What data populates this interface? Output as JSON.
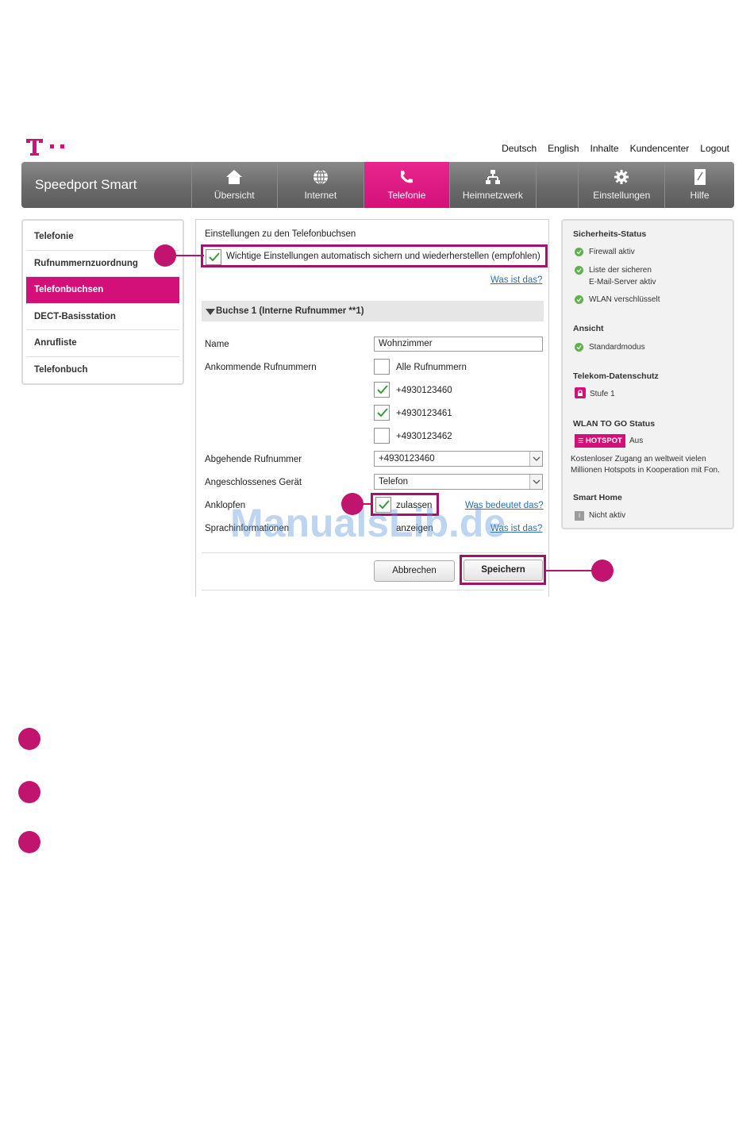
{
  "colors": {
    "magenta": "#d3107a",
    "callout": "#c0146e",
    "nav_gray": "#6a6a6a",
    "link": "#2f6ea8",
    "status_green": "#5fb14b"
  },
  "top_links": [
    "Deutsch",
    "English",
    "Inhalte",
    "Kundencenter",
    "Logout"
  ],
  "brand": "Speedport Smart",
  "nav": [
    {
      "label": "Übersicht",
      "icon": "home-icon"
    },
    {
      "label": "Internet",
      "icon": "globe-icon"
    },
    {
      "label": "Telefonie",
      "icon": "phone-icon",
      "active": true
    },
    {
      "label": "Heimnetzwerk",
      "icon": "network-icon"
    },
    {
      "label": "Einstellungen",
      "icon": "gear-icon"
    },
    {
      "label": "Hilfe",
      "icon": "help-book-icon"
    }
  ],
  "sidebar": {
    "items": [
      {
        "label": "Telefonie"
      },
      {
        "label": "Rufnummernzuordnung"
      },
      {
        "label": "Telefonbuchsen",
        "active": true
      },
      {
        "label": "DECT-Basisstation"
      },
      {
        "label": "Anrufliste"
      },
      {
        "label": "Telefonbuch"
      }
    ]
  },
  "main": {
    "title": "Einstellungen zu den Telefonbuchsen",
    "auto_save_label": "Wichtige Einstellungen automatisch sichern und wiederherstellen (empfohlen)",
    "auto_save_checked": true,
    "help_link": "Was ist das?",
    "section_title": "Buchse 1 (Interne Rufnummer **1)",
    "name_label": "Name",
    "name_value": "Wohnzimmer",
    "incoming_label": "Ankommende Rufnummern",
    "incoming_options": [
      {
        "label": "Alle Rufnummern",
        "checked": false
      },
      {
        "label": "+4930123460",
        "checked": true
      },
      {
        "label": "+4930123461",
        "checked": true
      },
      {
        "label": "+4930123462",
        "checked": false
      }
    ],
    "outgoing_label": "Abgehende Rufnummer",
    "outgoing_value": "+4930123460",
    "device_label": "Angeschlossenes Gerät",
    "device_value": "Telefon",
    "call_waiting_label": "Anklopfen",
    "call_waiting_option": "zulassen",
    "call_waiting_checked": true,
    "call_waiting_link": "Was bedeutet das?",
    "voice_info_label": "Sprachinformationen",
    "voice_info_option": "anzeigen",
    "voice_info_link": "Was ist das?",
    "cancel_label": "Abbrechen",
    "save_label": "Speichern"
  },
  "status": {
    "security_title": "Sicherheits-Status",
    "firewall": "Firewall aktiv",
    "mailserver_line1": "Liste der sicheren",
    "mailserver_line2": "E-Mail-Server aktiv",
    "wlan": "WLAN verschlüsselt",
    "view_title": "Ansicht",
    "view_mode": "Standardmodus",
    "privacy_title": "Telekom-Datenschutz",
    "privacy_level": "Stufe 1",
    "wlan_to_go_title": "WLAN TO GO Status",
    "hotspot_badge": "HOTSPOT",
    "hotspot_state": "Aus",
    "hotspot_desc_line1": "Kostenloser Zugang an weltweit vielen",
    "hotspot_desc_line2": "Millionen Hotspots in Kooperation mit Fon.",
    "smart_home_title": "Smart Home",
    "smart_home_state": "Nicht aktiv"
  },
  "watermark": "ManualsLib.de"
}
